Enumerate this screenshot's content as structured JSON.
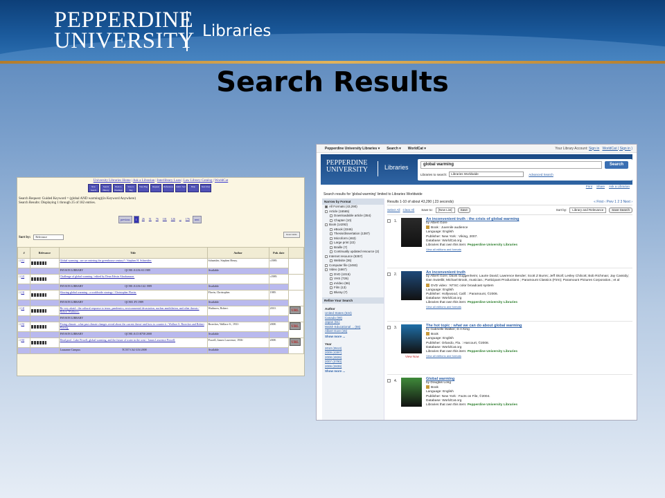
{
  "banner": {
    "logo_line1": "PEPPERDINE",
    "logo_line2": "UNIVERSITY",
    "logo_libraries": "Libraries"
  },
  "slide_title": "Search Results",
  "old_catalog": {
    "links": [
      "University Libraries Home",
      "Ask a Librarian",
      "Interlibrary Loan",
      "Law Library Catalog",
      "WorldCat"
    ],
    "nav_buttons": [
      "New Search",
      "Search History",
      "Back to Headings",
      "Save to Bag",
      "View Bag",
      "Request",
      "Preferences",
      "Limit / Sort",
      "Help",
      "Start Over"
    ],
    "info_line1": "Search Request: Guided Keyword = (global AND warming)(in Keyword Anywhere)",
    "info_line2": "Search Results: Displaying 1 through 25 of 182 entries.",
    "pager": [
      "previous",
      "1",
      "26",
      "51",
      "76",
      "101",
      "126",
      "...",
      "176",
      "next"
    ],
    "sort_label": "Sort by:",
    "sort_value": "Relevance",
    "reset_label": "Reset Limits",
    "table_headers": [
      "#",
      "Relevance",
      "Title",
      "Author",
      "Pub. date"
    ],
    "records": [
      {
        "num": "[1]",
        "title": "Global warming : are we entering the greenhouse century? / Stephen H. Schneider.",
        "author": "Schneider, Stephen Henry.",
        "date": "c1989.",
        "holding": "PAYSON LIBRARY",
        "call": "QC981.8.G56 S3 1989",
        "status": "Available",
        "url": false
      },
      {
        "num": "[2]",
        "title": "Challenge of global warming / edited by Dean Edwin Abrahamson.",
        "author": "",
        "date": "c1989.",
        "holding": "PAYSON LIBRARY",
        "call": "QC981.8.G56 C42 1989",
        "status": "Available",
        "url": false
      },
      {
        "num": "[3]",
        "title": "Slowing global warming : a worldwide strategy / Christopher Flavin.",
        "author": "Flavin, Christopher.",
        "date": "1989.",
        "holding": "PAYSON LIBRARY",
        "call": "QC903 .F5 1989",
        "status": "Available",
        "url": false
      },
      {
        "num": "[4]",
        "title": "Be very afraid : the cultural response to terror, pandemics, environmental devastation, nuclear annihilation, and other threats / Robert Wuthnow.",
        "author": "Wuthnow, Robert.",
        "date": "2010.",
        "holding": "PAYSON LIBRARY",
        "call": "",
        "status": "",
        "url": true
      },
      {
        "num": "[5]",
        "title": "Fixing climate : what past climate changes reveal about the current threat--and how to counter it / Wallace S. Broecker and Robert Kunzig.",
        "author": "Broecker, Wallace S., 1931-",
        "date": "2008.",
        "holding": "PAYSON LIBRARY",
        "call": "QC981.8.C5 B758 2008",
        "status": "Available",
        "url": true
      },
      {
        "num": "[6]",
        "title": "Dead pool : Lake Powell, global warming, and the future of water in the west / James Lawrence Powell.",
        "author": "Powell, James Lawrence, 1936-",
        "date": "2008.",
        "holding": "Lausanne Campus",
        "call": "TC557.C62 G54 2008",
        "status": "Available",
        "url": true
      }
    ],
    "url_label": "URL"
  },
  "worldcat": {
    "topbar": {
      "items": [
        "Pepperdine University Libraries ▾",
        "Search ▾",
        "WorldCat ▾"
      ],
      "account": "Your Library Account:",
      "sign_in": "Sign in",
      "worldcat_sign_in": "WorldCat ( Sign in )"
    },
    "logo_line1": "PEPPERDINE",
    "logo_line2": "UNIVERSITY",
    "logo_libraries": "Libraries",
    "query": "global warming",
    "search_button": "Search",
    "limit_label": "Libraries to search:",
    "limit_value": "Libraries Worldwide",
    "advanced": "Advanced Search",
    "tools": [
      "Print",
      "Share",
      "Ask a Librarian"
    ],
    "crumb": "Search results for 'global warming' limited to Libraries Worldwide",
    "sidebar": {
      "format_header": "Narrow by Format",
      "formats": [
        {
          "label": "All Formats (43,290)",
          "sub": false
        },
        {
          "label": "Article (16565)",
          "sub": false
        },
        {
          "label": "Downloadable article (354)",
          "sub": true
        },
        {
          "label": "Chapter (10)",
          "sub": true
        },
        {
          "label": "Book (14292)",
          "sub": false
        },
        {
          "label": "eBook (3346)",
          "sub": true
        },
        {
          "label": "Thesis/dissertation (1387)",
          "sub": true
        },
        {
          "label": "Microform (463)",
          "sub": true
        },
        {
          "label": "Large print (22)",
          "sub": true
        },
        {
          "label": "Braille (7)",
          "sub": true
        },
        {
          "label": "Continually updated resource (2)",
          "sub": true
        },
        {
          "label": "Internet resource (5357)",
          "sub": false
        },
        {
          "label": "Website (36)",
          "sub": true
        },
        {
          "label": "Computer file (2493)",
          "sub": false
        },
        {
          "label": "Video (1667)",
          "sub": false
        },
        {
          "label": "DVD (1015)",
          "sub": true
        },
        {
          "label": "VHS (726)",
          "sub": true
        },
        {
          "label": "eVideo (96)",
          "sub": true
        },
        {
          "label": "Film (13)",
          "sub": true
        },
        {
          "label": "Bluray (7)",
          "sub": true
        }
      ],
      "refine_header": "Refine Your Search",
      "author_header": "Author",
      "authors": [
        "United States (534)",
        "Canada (99)",
        "Japan (61)",
        "Walsh Educational ... (55)",
        "Albert Gore (45)"
      ],
      "year_header": "Year",
      "years": [
        "2010 (3513)",
        "2009 (4397)",
        "2008 (4826)",
        "2007 (3790)",
        "2006 (2839)"
      ],
      "show_more": "Show more ..."
    },
    "results_count": "Results 1-10 of about 43,290 (.23 seconds)",
    "pager": "« First  ‹ Prev  1  2  3  Next ›",
    "select_all": "Select All",
    "clear_all": "Clear All",
    "save_to_label": "Save to:",
    "save_to_value": "[New List]",
    "save_button": "Save",
    "sort_label": "Sort by:",
    "sort_value": "Library and Relevance",
    "save_search": "Save Search",
    "results": [
      {
        "num": "1.",
        "title": "An inconvenient truth : the crisis of global warming",
        "by": "by Albert Gore",
        "lines": [
          "Book : Juvenile audience",
          "Language: English",
          "Publisher: New York : Viking, 2007.",
          "Database: WorldCat.org"
        ],
        "libs_label": "Libraries that own this item:",
        "libs_value": "Pepperdine University Libraries",
        "view_all": "View all editions and formats",
        "cover_color": "#2a2a2a",
        "view_now": ""
      },
      {
        "num": "2.",
        "title": "An inconvenient truth",
        "by": "by Albert Gore; Davis Guggenheim; Laurie David; Lawrence Bender; Scott Z Burns; Jeff Skoll; Lesley Chilcott; Bob Richman; Jay Cassidy; Dan Swietlik; Michael Brook, musician.; Participant Productions ; Paramount Classics (Firm); Paramount Pictures Corporation.; et al",
        "lines": [
          "DVD video : NTSC color broadcast system",
          "Language: English",
          "Publisher: Hollywood, Calif. : Paramount, ©2006.",
          "Database: WorldCat.org"
        ],
        "libs_label": "Libraries that own this item:",
        "libs_value": "Pepperdine University Libraries",
        "view_all": "View all editions and formats",
        "cover_color": "#1e4a7a",
        "view_now": ""
      },
      {
        "num": "3.",
        "title": "The hot topic : what we can do about global warming",
        "by": "by Gabrielle Walker; D A King",
        "lines": [
          "Book",
          "Language: English",
          "Publisher: Orlando, Fla. : Harcourt, ©2008.",
          "Database: WorldCat.org"
        ],
        "libs_label": "Libraries that own this item:",
        "libs_value": "Pepperdine University Libraries",
        "view_all": "View all editions and formats",
        "cover_color": "#1f6fa8",
        "view_now": "View Now"
      },
      {
        "num": "4.",
        "title": "Global warming",
        "by": "by Douglas Long",
        "lines": [
          "Book",
          "Language: English",
          "Publisher: New York : Facts on File, ©2004.",
          "Database: WorldCat.org"
        ],
        "libs_label": "Libraries that own this item:",
        "libs_value": "Pepperdine University Libraries",
        "view_all": "",
        "cover_color": "#3f8a3a",
        "view_now": ""
      }
    ]
  }
}
